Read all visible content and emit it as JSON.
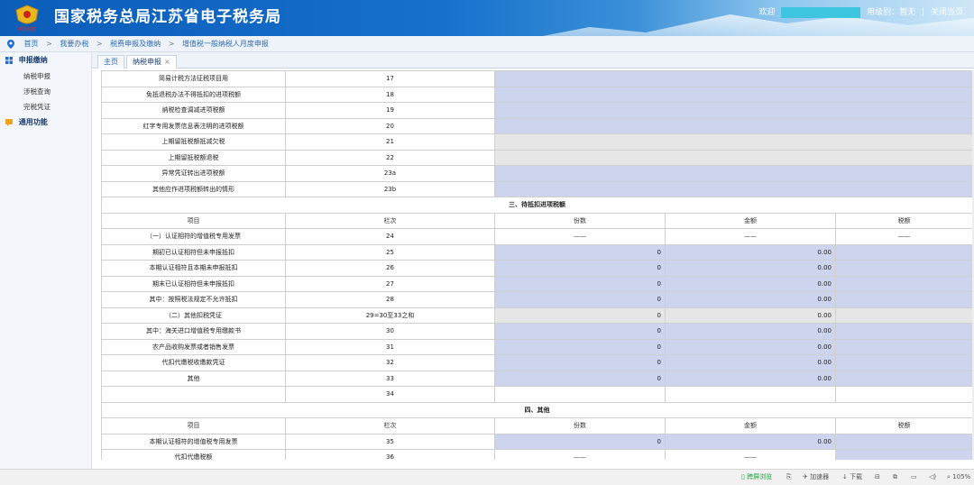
{
  "header": {
    "title": "国家税务总局江苏省电子税务局",
    "logo_text": "中国税务",
    "welcome": "欢迎",
    "level_label": "用级别：暂无",
    "close_label": "关闭当页"
  },
  "breadcrumb": [
    "首页",
    "我要办税",
    "税费申报及缴纳",
    "增值税一般纳税人月度申报"
  ],
  "sidebar": {
    "groups": [
      {
        "label": "申报缴纳",
        "items": [
          "纳税申报",
          "涉税查询",
          "完税凭证"
        ]
      },
      {
        "label": "通用功能",
        "items": []
      }
    ]
  },
  "tabs": [
    {
      "label": "主页",
      "active": false
    },
    {
      "label": "纳税申报",
      "active": true,
      "close": "×"
    }
  ],
  "table": {
    "top_rows": [
      {
        "item": "简易计税方法征税项目用",
        "line": "17",
        "style": "blue"
      },
      {
        "item": "免抵退税办法不得抵扣的进项税额",
        "line": "18",
        "style": "blue"
      },
      {
        "item": "纳税检查调减进项税额",
        "line": "19",
        "style": "blue"
      },
      {
        "item": "红字专用发票信息表注明的进项税额",
        "line": "20",
        "style": "blue"
      },
      {
        "item": "上期留抵税额抵减欠税",
        "line": "21",
        "style": "gray"
      },
      {
        "item": "上期留抵税额退税",
        "line": "22",
        "style": "gray"
      },
      {
        "item": "异常凭证转出进项税额",
        "line": "23a",
        "style": "blue"
      },
      {
        "item": "其他应作进项税额转出的情形",
        "line": "23b",
        "style": "blue"
      }
    ],
    "section3": {
      "title": "三、待抵扣进项税额",
      "headers": [
        "项目",
        "栏次",
        "份数",
        "金额",
        "税额"
      ],
      "rows": [
        {
          "item": "（一）认证相符的增值税专用发票",
          "line": "24",
          "count": "——",
          "amount": "——",
          "tax": "——",
          "style": "dash"
        },
        {
          "item": "期初已认证相符但未申报抵扣",
          "line": "25",
          "count": "0",
          "amount": "0.00",
          "tax": "",
          "style": "blue"
        },
        {
          "item": "本期认证相符且本期未申报抵扣",
          "line": "26",
          "count": "0",
          "amount": "0.00",
          "tax": "",
          "style": "blue"
        },
        {
          "item": "期末已认证相符但未申报抵扣",
          "line": "27",
          "count": "0",
          "amount": "0.00",
          "tax": "",
          "style": "blue"
        },
        {
          "item": "其中：按照税法规定不允许抵扣",
          "line": "28",
          "count": "0",
          "amount": "0.00",
          "tax": "",
          "style": "blue"
        },
        {
          "item": "（二）其他扣税凭证",
          "line": "29=30至33之和",
          "count": "0",
          "amount": "0.00",
          "tax": "",
          "style": "gray"
        },
        {
          "item": "其中：海关进口增值税专用缴款书",
          "line": "30",
          "count": "0",
          "amount": "0.00",
          "tax": "",
          "style": "blue"
        },
        {
          "item": "农产品收购发票或者销售发票",
          "line": "31",
          "count": "0",
          "amount": "0.00",
          "tax": "",
          "style": "blue"
        },
        {
          "item": "代扣代缴税收缴款凭证",
          "line": "32",
          "count": "0",
          "amount": "0.00",
          "tax": "",
          "style": "blue"
        },
        {
          "item": "其他",
          "line": "33",
          "count": "0",
          "amount": "0.00",
          "tax": "",
          "style": "blue"
        },
        {
          "item": "",
          "line": "34",
          "count": "",
          "amount": "",
          "tax": "",
          "style": "empty"
        }
      ]
    },
    "section4": {
      "title": "四、其他",
      "headers": [
        "项目",
        "栏次",
        "份数",
        "金额",
        "税额"
      ],
      "rows": [
        {
          "item": "本期认证相符的增值税专用发票",
          "line": "35",
          "count": "0",
          "amount": "0.00",
          "tax": "",
          "style": "blue"
        },
        {
          "item": "代扣代缴税额",
          "line": "36",
          "count": "——",
          "amount": "——",
          "tax": "",
          "style": "mixed"
        }
      ]
    }
  },
  "statusbar": {
    "browse": "跨屏浏览",
    "accelerator": "加速器",
    "download": "下载",
    "zoom": "105%"
  },
  "colors": {
    "header_blue": "#0b5db8",
    "cell_blue": "#cdd4ee",
    "cell_gray": "#e6e6e6",
    "link_blue": "#2a6ab8"
  }
}
